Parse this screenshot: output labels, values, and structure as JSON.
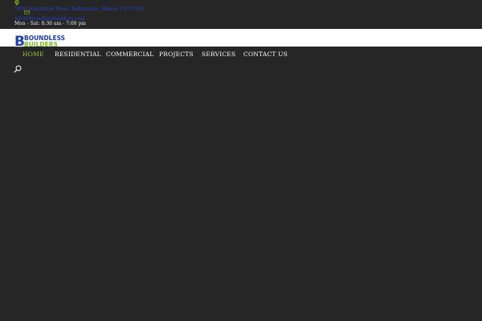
{
  "topbar": {
    "address": "5436 Southfront Road, Bellarmine, Illinois US 57493",
    "email": "info@boundlessbuilders.com",
    "hours": "Mon - Sat: 8:30 am - 7:00 pm"
  },
  "logo": {
    "line1": "BOUNDLESS",
    "line2": "BUILDERS",
    "initial": "B"
  },
  "nav": {
    "items": [
      {
        "label": "HOME"
      },
      {
        "label": "RESIDENTIAL"
      },
      {
        "label": "COMMERCIAL"
      },
      {
        "label": "PROJECTS"
      },
      {
        "label": "SERVICES"
      },
      {
        "label": "CONTACT US"
      }
    ]
  },
  "colors": {
    "background": "#262626",
    "accent": "#9bc93a",
    "link": "#2a3fd0",
    "logo_blue": "#1f3fa8",
    "logo_green": "#7fb82e"
  },
  "icons": [
    "location-pin-icon",
    "envelope-icon",
    "search-icon"
  ]
}
